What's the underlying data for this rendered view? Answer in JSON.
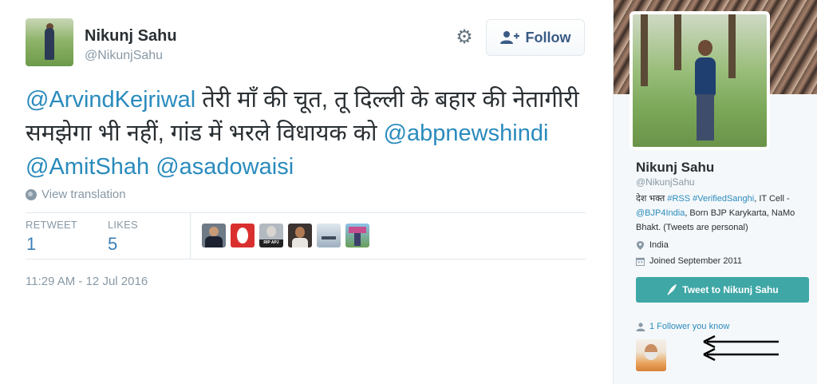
{
  "tweet": {
    "author_name": "Nikunj Sahu",
    "author_handle": "@NikunjSahu",
    "follow_label": "Follow",
    "text_parts": [
      {
        "type": "mention",
        "text": "@ArvindKejriwal"
      },
      {
        "type": "text",
        "text": " तेरी माँ की चूत, तू दिल्ली के बहार की नेतागीरी समझेगा भी नहीं, गांड में भरले विधायक को "
      },
      {
        "type": "mention",
        "text": "@abpnewshindi"
      },
      {
        "type": "text",
        "text": " "
      },
      {
        "type": "mention",
        "text": "@AmitShah"
      },
      {
        "type": "text",
        "text": " "
      },
      {
        "type": "mention",
        "text": "@asadowaisi"
      }
    ],
    "view_translation": "View translation",
    "retweet_label": "RETWEET",
    "retweet_count": "1",
    "likes_label": "LIKES",
    "likes_count": "5",
    "liker_badge": "RIP APJ",
    "timestamp": "11:29 AM - 12 Jul 2016"
  },
  "profile": {
    "name": "Nikunj Sahu",
    "handle": "@NikunjSahu",
    "bio_prefix": "देश भक्त ",
    "bio_tag1": "#RSS",
    "bio_tag2": "#VerifiedSanghi",
    "bio_mid": ", IT Cell - ",
    "bio_mention": "@BJP4India",
    "bio_suffix": ", Born BJP Karykarta, NaMo Bhakt. (Tweets are personal)",
    "location": "India",
    "joined": "Joined September 2011",
    "tweet_to_label": "Tweet to Nikunj Sahu",
    "followers_you_know": "1 Follower you know"
  },
  "colors": {
    "link": "#2a8bbd",
    "tweet_to_button": "#3fa7a6",
    "muted": "#8899a6"
  }
}
